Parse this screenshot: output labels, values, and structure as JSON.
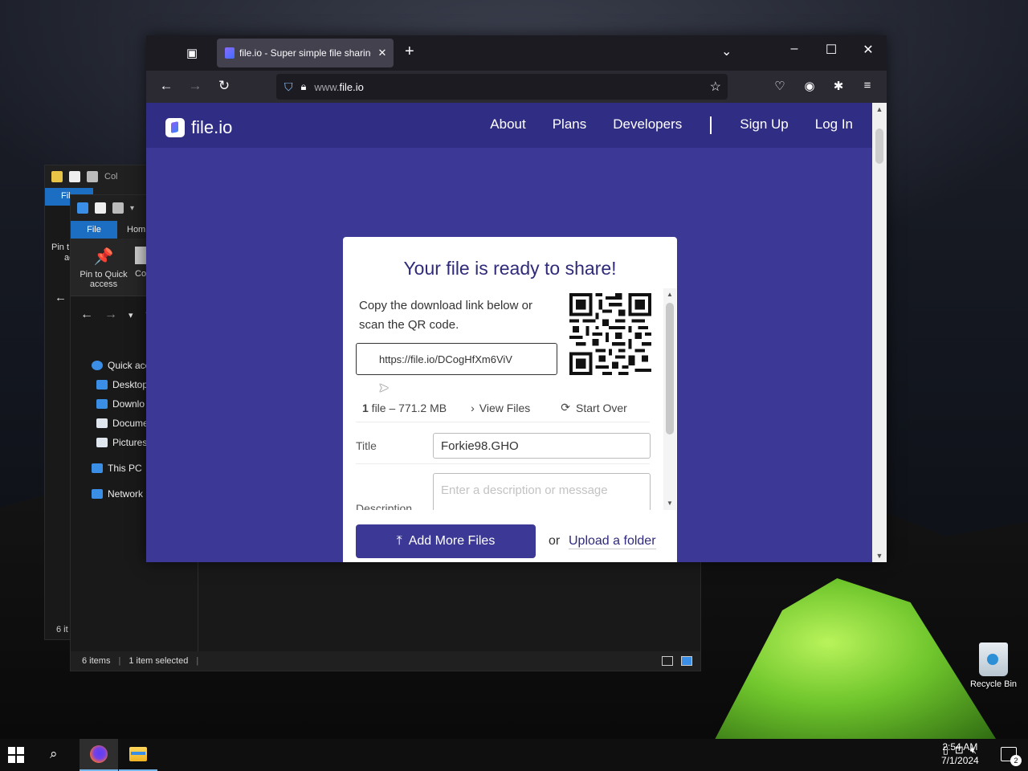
{
  "desktop": {
    "recycle_bin_label": "Recycle Bin"
  },
  "explorer_back": {
    "qat_label": "Col",
    "file_tab": "Fil",
    "pin_label": "Pin t",
    "pin_label2": "ac",
    "status": "6 it"
  },
  "explorer": {
    "file_tab": "File",
    "home_tab": "Hom",
    "pin_label": "Pin to Quick access",
    "copy_label": "Co",
    "nav_items": [
      {
        "label": "Quick acc",
        "icon": "star-icon",
        "color": "#3a8ee6"
      },
      {
        "label": "Desktop",
        "icon": "desktop-icon",
        "color": "#3a8ee6"
      },
      {
        "label": "Downlo",
        "icon": "download-icon",
        "color": "#3a8ee6"
      },
      {
        "label": "Docume",
        "icon": "document-icon",
        "color": "#dfe6ee"
      },
      {
        "label": "Pictures",
        "icon": "pictures-icon",
        "color": "#dfe6ee"
      },
      {
        "label": "This PC",
        "icon": "computer-icon",
        "color": "#3a8ee6"
      },
      {
        "label": "Network",
        "icon": "network-icon",
        "color": "#3a8ee6"
      }
    ],
    "status_items": "6 items",
    "status_selected": "1 item selected"
  },
  "browser": {
    "tab_title": "file.io - Super simple file sharing",
    "url_dim": "www.",
    "url_main": "file.io",
    "window_controls": {
      "minimize": "–",
      "maximize": "☐",
      "close": "✕"
    }
  },
  "site": {
    "logo_text": "file.io",
    "nav": [
      "About",
      "Plans",
      "Developers",
      "Sign Up",
      "Log In"
    ],
    "accent": "#3c3996",
    "header_bg": "#302d84"
  },
  "card": {
    "title": "Your file is ready to share!",
    "copy_text": "Copy the download link below or scan the QR code.",
    "link": "https://file.io/DCogHfXm6ViV",
    "file_count": "1",
    "file_count_suffix": " file – 771.2 MB",
    "view_files": "View Files",
    "start_over": "Start Over",
    "title_label": "Title",
    "title_value": "Forkie98.GHO",
    "description_label": "Description",
    "description_placeholder": "Enter a description or message",
    "add_more_files": "Add More Files",
    "or_text": "or",
    "upload_folder": "Upload a folder"
  },
  "taskbar": {
    "time": "2:54 AM",
    "date": "7/1/2024",
    "notification_count": "2"
  }
}
